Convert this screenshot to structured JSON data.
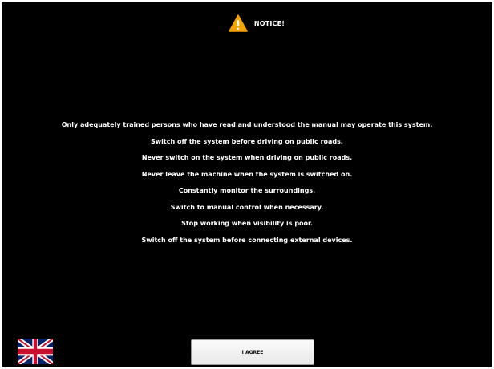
{
  "header": {
    "title": "NOTICE!",
    "icon": "warning-icon",
    "icon_color": "#f5a300"
  },
  "notices": [
    "Only adequately trained persons who have read and understood the manual may operate this system.",
    "Switch off the system before driving on public roads.",
    "Never switch on the system when driving on public roads.",
    "Never leave the machine when the system is switched on.",
    "Constantly monitor the surroundings.",
    "Switch to manual control when necessary.",
    "Stop working when visibility is poor.",
    "Switch off the system before connecting external devices."
  ],
  "language": {
    "icon": "uk-flag-icon"
  },
  "agree_button": {
    "label": "I AGREE"
  },
  "colors": {
    "background": "#000000",
    "text": "#ffffff",
    "button_background": "#f0f0f0"
  }
}
